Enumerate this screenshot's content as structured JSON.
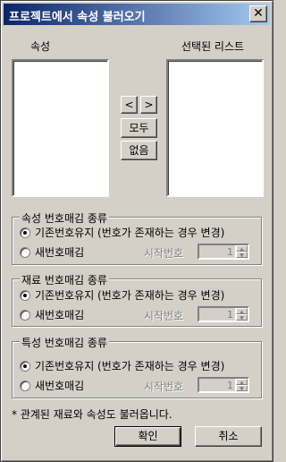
{
  "window": {
    "title": "프로젝트에서 속성 불러오기"
  },
  "lists": {
    "left_label": "속성",
    "right_label": "선택된 리스트"
  },
  "buttons": {
    "move_left": "<",
    "move_right": ">",
    "all": "모두",
    "none": "없음",
    "ok": "확인",
    "cancel": "취소"
  },
  "groups": [
    {
      "title": "속성 번호매김 종류",
      "option_keep": "기존번호유지 (번호가 존재하는 경우 변경)",
      "option_new": "새번호매김",
      "start_label": "시작번호",
      "start_value": "1",
      "selected": "keep"
    },
    {
      "title": "재료 번호매김 종류",
      "option_keep": "기존번호유지 (번호가 존재하는 경우 변경)",
      "option_new": "새번호매김",
      "start_label": "시작번호",
      "start_value": "1",
      "selected": "keep"
    },
    {
      "title": "특성 번호매김 종류",
      "option_keep": "기존번호유지 (번호가 존재하는 경우 변경)",
      "option_new": "새번호매김",
      "start_label": "시작번호",
      "start_value": "1",
      "selected": "keep"
    }
  ],
  "note": "* 관계된 재료와 속성도 불러옵니다."
}
